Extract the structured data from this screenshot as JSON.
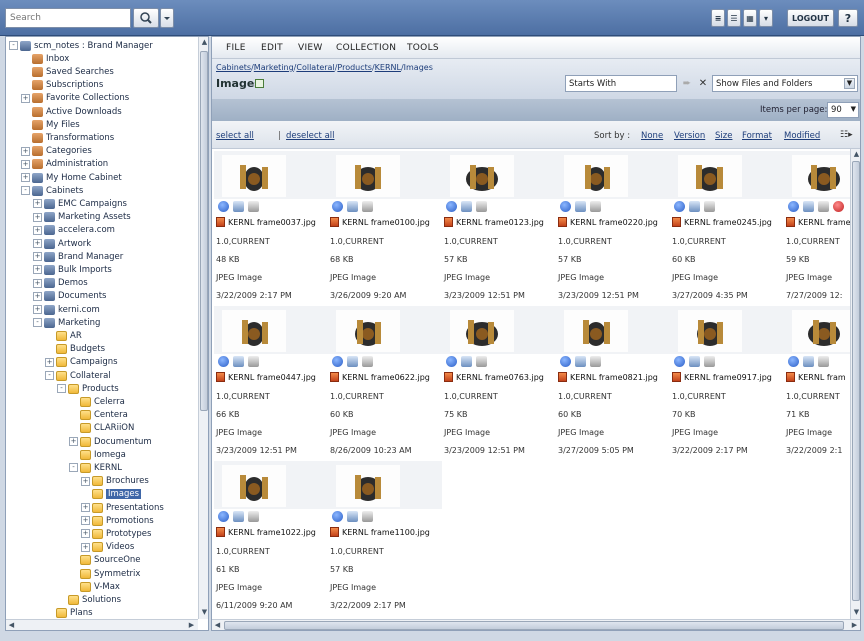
{
  "topbar": {
    "search_placeholder": "Search",
    "logout_label": "LOGOUT",
    "help_label": "?"
  },
  "tree": [
    {
      "label": "scm_notes : Brand Manager",
      "indent": 0,
      "toggle": "-",
      "icon": "cab"
    },
    {
      "label": "Inbox",
      "indent": 1,
      "toggle": "",
      "icon": "misc"
    },
    {
      "label": "Saved Searches",
      "indent": 1,
      "toggle": "",
      "icon": "misc"
    },
    {
      "label": "Subscriptions",
      "indent": 1,
      "toggle": "",
      "icon": "misc"
    },
    {
      "label": "Favorite Collections",
      "indent": 1,
      "toggle": "+",
      "icon": "misc"
    },
    {
      "label": "Active Downloads",
      "indent": 1,
      "toggle": "",
      "icon": "misc"
    },
    {
      "label": "My Files",
      "indent": 1,
      "toggle": "",
      "icon": "misc"
    },
    {
      "label": "Transformations",
      "indent": 1,
      "toggle": "",
      "icon": "misc"
    },
    {
      "label": "Categories",
      "indent": 1,
      "toggle": "+",
      "icon": "misc"
    },
    {
      "label": "Administration",
      "indent": 1,
      "toggle": "+",
      "icon": "misc"
    },
    {
      "label": "My Home Cabinet",
      "indent": 1,
      "toggle": "+",
      "icon": "cab"
    },
    {
      "label": "Cabinets",
      "indent": 1,
      "toggle": "-",
      "icon": "cab"
    },
    {
      "label": "EMC Campaigns",
      "indent": 2,
      "toggle": "+",
      "icon": "cab"
    },
    {
      "label": "Marketing Assets",
      "indent": 2,
      "toggle": "+",
      "icon": "cab"
    },
    {
      "label": "accelera.com",
      "indent": 2,
      "toggle": "+",
      "icon": "cab"
    },
    {
      "label": "Artwork",
      "indent": 2,
      "toggle": "+",
      "icon": "cab"
    },
    {
      "label": "Brand Manager",
      "indent": 2,
      "toggle": "+",
      "icon": "cab"
    },
    {
      "label": "Bulk Imports",
      "indent": 2,
      "toggle": "+",
      "icon": "cab"
    },
    {
      "label": "Demos",
      "indent": 2,
      "toggle": "+",
      "icon": "cab"
    },
    {
      "label": "Documents",
      "indent": 2,
      "toggle": "+",
      "icon": "cab"
    },
    {
      "label": "kerni.com",
      "indent": 2,
      "toggle": "+",
      "icon": "cab"
    },
    {
      "label": "Marketing",
      "indent": 2,
      "toggle": "-",
      "icon": "cab"
    },
    {
      "label": "AR",
      "indent": 3,
      "toggle": "",
      "icon": "folder"
    },
    {
      "label": "Budgets",
      "indent": 3,
      "toggle": "",
      "icon": "folder"
    },
    {
      "label": "Campaigns",
      "indent": 3,
      "toggle": "+",
      "icon": "folder"
    },
    {
      "label": "Collateral",
      "indent": 3,
      "toggle": "-",
      "icon": "folder"
    },
    {
      "label": "Products",
      "indent": 4,
      "toggle": "-",
      "icon": "folder"
    },
    {
      "label": "Celerra",
      "indent": 5,
      "toggle": "",
      "icon": "folder"
    },
    {
      "label": "Centera",
      "indent": 5,
      "toggle": "",
      "icon": "folder"
    },
    {
      "label": "CLARiiON",
      "indent": 5,
      "toggle": "",
      "icon": "folder"
    },
    {
      "label": "Documentum",
      "indent": 5,
      "toggle": "+",
      "icon": "folder"
    },
    {
      "label": "Iomega",
      "indent": 5,
      "toggle": "",
      "icon": "folder"
    },
    {
      "label": "KERNL",
      "indent": 5,
      "toggle": "-",
      "icon": "folder"
    },
    {
      "label": "Brochures",
      "indent": 6,
      "toggle": "+",
      "icon": "folder"
    },
    {
      "label": "Images",
      "indent": 6,
      "toggle": "",
      "icon": "folder",
      "selected": true
    },
    {
      "label": "Presentations",
      "indent": 6,
      "toggle": "+",
      "icon": "folder"
    },
    {
      "label": "Promotions",
      "indent": 6,
      "toggle": "+",
      "icon": "folder"
    },
    {
      "label": "Prototypes",
      "indent": 6,
      "toggle": "+",
      "icon": "folder"
    },
    {
      "label": "Videos",
      "indent": 6,
      "toggle": "+",
      "icon": "folder"
    },
    {
      "label": "SourceOne",
      "indent": 5,
      "toggle": "",
      "icon": "folder"
    },
    {
      "label": "Symmetrix",
      "indent": 5,
      "toggle": "",
      "icon": "folder"
    },
    {
      "label": "V-Max",
      "indent": 5,
      "toggle": "",
      "icon": "folder"
    },
    {
      "label": "Solutions",
      "indent": 4,
      "toggle": "",
      "icon": "folder"
    },
    {
      "label": "Plans",
      "indent": 3,
      "toggle": "",
      "icon": "folder"
    }
  ],
  "menu": [
    "FILE",
    "EDIT",
    "VIEW",
    "COLLECTION",
    "TOOLS"
  ],
  "breadcrumb": [
    "Cabinets",
    "Marketing",
    "Collateral",
    "Products",
    "KERNL",
    "Images"
  ],
  "page_title": "Images",
  "filter": {
    "value": "Starts With",
    "show_option": "Show Files and Folders"
  },
  "items_per_page": {
    "label": "Items per page:",
    "value": "90"
  },
  "selection": {
    "select_all": "select all",
    "separator": "|",
    "deselect_all": "deselect all"
  },
  "sort": {
    "label": "Sort by :",
    "options": [
      "None",
      "Version",
      "Size",
      "Format",
      "Modified"
    ]
  },
  "files": [
    {
      "name": "KERNL frame0037.jpg",
      "version": "1.0,CURRENT",
      "size": "48 KB",
      "format": "JPEG Image",
      "date": "3/22/2009 2:17 PM"
    },
    {
      "name": "KERNL frame0100.jpg",
      "version": "1.0,CURRENT",
      "size": "68 KB",
      "format": "JPEG Image",
      "date": "3/26/2009 9:20 AM"
    },
    {
      "name": "KERNL frame0123.jpg",
      "version": "1.0,CURRENT",
      "size": "57 KB",
      "format": "JPEG Image",
      "date": "3/23/2009 12:51 PM"
    },
    {
      "name": "KERNL frame0220.jpg",
      "version": "1.0,CURRENT",
      "size": "57 KB",
      "format": "JPEG Image",
      "date": "3/23/2009 12:51 PM"
    },
    {
      "name": "KERNL frame0245.jpg",
      "version": "1.0,CURRENT",
      "size": "60 KB",
      "format": "JPEG Image",
      "date": "3/27/2009 4:35 PM"
    },
    {
      "name": "KERNL frame",
      "version": "1.0,CURRENT",
      "size": "59 KB",
      "format": "JPEG Image",
      "date": "7/27/2009 12:",
      "locked": true
    },
    {
      "name": "KERNL frame0447.jpg",
      "version": "1.0,CURRENT",
      "size": "66 KB",
      "format": "JPEG Image",
      "date": "3/23/2009 12:51 PM"
    },
    {
      "name": "KERNL frame0622.jpg",
      "version": "1.0,CURRENT",
      "size": "60 KB",
      "format": "JPEG Image",
      "date": "8/26/2009 10:23 AM"
    },
    {
      "name": "KERNL frame0763.jpg",
      "version": "1.0,CURRENT",
      "size": "75 KB",
      "format": "JPEG Image",
      "date": "3/23/2009 12:51 PM"
    },
    {
      "name": "KERNL frame0821.jpg",
      "version": "1.0,CURRENT",
      "size": "60 KB",
      "format": "JPEG Image",
      "date": "3/27/2009 5:05 PM"
    },
    {
      "name": "KERNL frame0917.jpg",
      "version": "1.0,CURRENT",
      "size": "70 KB",
      "format": "JPEG Image",
      "date": "3/22/2009 2:17 PM"
    },
    {
      "name": "KERNL fram",
      "version": "1.0,CURRENT",
      "size": "71 KB",
      "format": "JPEG Image",
      "date": "3/22/2009 2:1"
    },
    {
      "name": "KERNL frame1022.jpg",
      "version": "1.0,CURRENT",
      "size": "61 KB",
      "format": "JPEG Image",
      "date": "6/11/2009 9:20 AM"
    },
    {
      "name": "KERNL frame1100.jpg",
      "version": "1.0,CURRENT",
      "size": "57 KB",
      "format": "JPEG Image",
      "date": "3/22/2009 2:17 PM"
    }
  ],
  "icons": {
    "info": "info-icon",
    "properties": "properties-icon",
    "actions": "actions-icon",
    "locked": "locked-icon",
    "file": "jpeg-file-icon"
  }
}
